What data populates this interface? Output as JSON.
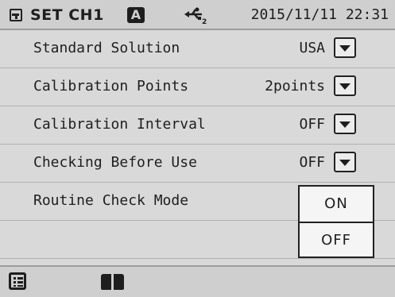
{
  "header": {
    "title": "SET CH1",
    "mode_badge": "A",
    "usb_icon": "usb-icon",
    "datetime": "2015/11/11 22:31"
  },
  "settings": [
    {
      "label": "Standard Solution",
      "value": "USA"
    },
    {
      "label": "Calibration Points",
      "value": "2points"
    },
    {
      "label": "Calibration Interval",
      "value": "OFF"
    },
    {
      "label": "Checking Before Use",
      "value": "OFF"
    },
    {
      "label": "Routine Check Mode",
      "value": ""
    }
  ],
  "popup": {
    "options": [
      "ON",
      "OFF"
    ]
  },
  "toolbar": {
    "icons": [
      "list-icon",
      "book-icon"
    ]
  },
  "colors": {
    "background": "#d9d9d9",
    "text": "#1e1e1e",
    "popup_bg": "#f5f5f5"
  }
}
